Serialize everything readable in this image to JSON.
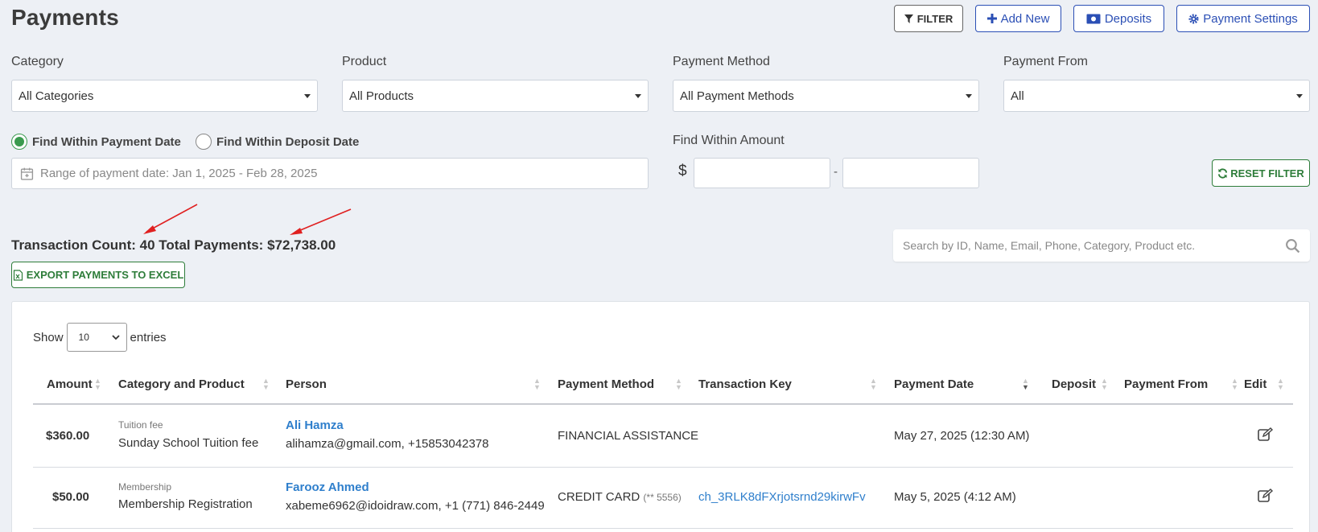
{
  "page": {
    "title": "Payments"
  },
  "toolbar": {
    "filter_label": "FILTER",
    "add_new_label": "Add New",
    "deposits_label": "Deposits",
    "payment_settings_label": "Payment Settings"
  },
  "filters": {
    "category": {
      "label": "Category",
      "value": "All Categories"
    },
    "product": {
      "label": "Product",
      "value": "All Products"
    },
    "payment_method": {
      "label": "Payment Method",
      "value": "All Payment Methods"
    },
    "payment_from": {
      "label": "Payment From",
      "value": "All"
    },
    "date_mode": {
      "payment_date_label": "Find Within Payment Date",
      "deposit_date_label": "Find Within Deposit Date",
      "selected": "payment_date"
    },
    "date_range_placeholder": "Range of payment date: Jan 1, 2025 - Feb 28, 2025",
    "amount": {
      "label": "Find Within Amount",
      "currency": "$",
      "separator": "-",
      "min": "",
      "max": ""
    },
    "reset_label": "RESET FILTER"
  },
  "summary": {
    "count_label": "Transaction Count:",
    "count": "40",
    "total_label": "Total Payments:",
    "total": "$72,738.00"
  },
  "export_label": "EXPORT PAYMENTS TO EXCEL",
  "search": {
    "placeholder": "Search by ID, Name, Email, Phone, Category, Product etc."
  },
  "table": {
    "show_label": "Show",
    "entries_value": "10",
    "entries_label": "entries",
    "columns": [
      "Amount",
      "Category and Product",
      "Person",
      "Payment Method",
      "Transaction Key",
      "Payment Date",
      "Deposit",
      "Payment From",
      "Edit"
    ],
    "rows": [
      {
        "amount": "$360.00",
        "category": "Tuition fee",
        "product": "Sunday School Tuition fee",
        "person_name": "Ali Hamza",
        "person_contact": "alihamza@gmail.com, +15853042378",
        "method": "FINANCIAL ASSISTANCE",
        "method_detail": "",
        "transaction_key": "",
        "payment_date": "May 27, 2025 (12:30 AM)"
      },
      {
        "amount": "$50.00",
        "category": "Membership",
        "product": "Membership Registration",
        "person_name": "Farooz Ahmed",
        "person_contact": "xabeme6962@idoidraw.com, +1 (771) 846-2449",
        "method": "CREDIT CARD",
        "method_detail": "(** 5556)",
        "transaction_key": "ch_3RLK8dFXrjotsrnd29kirwFv",
        "payment_date": "May 5, 2025 (4:12 AM)"
      }
    ]
  },
  "colors": {
    "primary": "#2b4fb5",
    "success": "#2e7d3a",
    "link": "#2f7fcc",
    "annotation_arrow": "#e02020"
  },
  "icons": [
    "filter-icon",
    "plus-icon",
    "money-icon",
    "gear-icon",
    "calendar-icon",
    "refresh-icon",
    "excel-icon",
    "search-icon",
    "edit-icon"
  ]
}
